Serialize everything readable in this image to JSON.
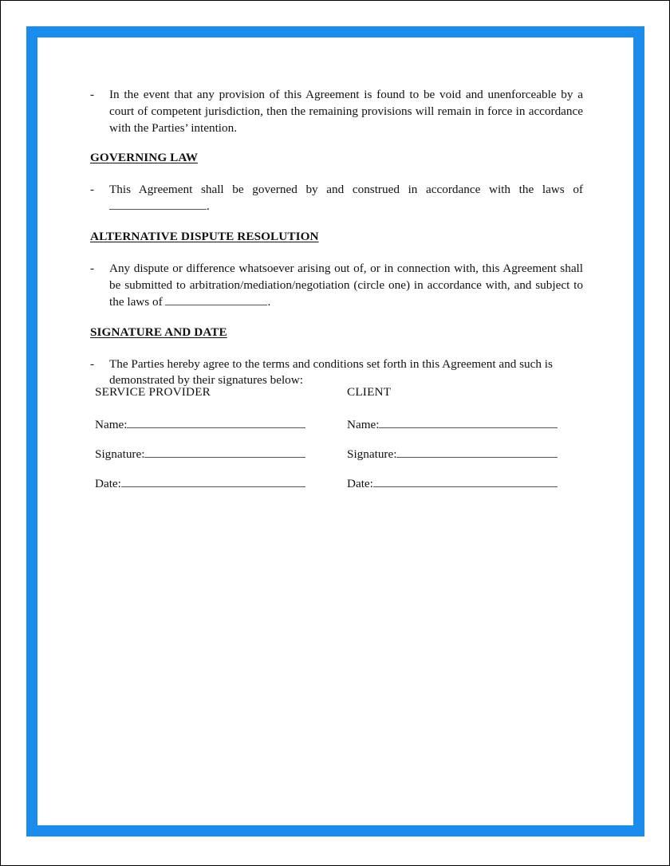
{
  "document": {
    "accent_color": "#1b8ceb",
    "page_border_color": "#000000",
    "bullet_marker": "-",
    "blocks": {
      "severability_item": "In the event that any provision of this Agreement is found to be void and unenforceable by a court of competent jurisdiction, then the remaining provisions will remain in force in accordance with the Parties’ intention.",
      "governing_law_heading": "GOVERNING LAW",
      "governing_law_item_before": "This Agreement shall be governed by and construed in accordance with the laws of",
      "governing_law_item_after": ".",
      "adr_heading": "ALTERNATIVE DISPUTE RESOLUTION",
      "adr_item_before": "Any dispute or difference whatsoever arising out of, or in connection with, this Agreement shall be submitted to arbitration/mediation/negotiation (circle one) in accordance with, and subject to the laws of",
      "adr_item_after": ".",
      "signature_heading": "SIGNATURE AND DATE",
      "signature_item": "The Parties hereby agree to the terms and conditions set forth in this Agreement and such is demonstrated by their signatures below:"
    },
    "signature_block": {
      "columns": [
        {
          "party": "SERVICE PROVIDER",
          "fields": [
            {
              "label": "Name:"
            },
            {
              "label": "Signature:"
            },
            {
              "label": "Date:"
            }
          ]
        },
        {
          "party": "CLIENT",
          "fields": [
            {
              "label": "Name:"
            },
            {
              "label": "Signature:"
            },
            {
              "label": "Date:"
            }
          ]
        }
      ]
    }
  }
}
